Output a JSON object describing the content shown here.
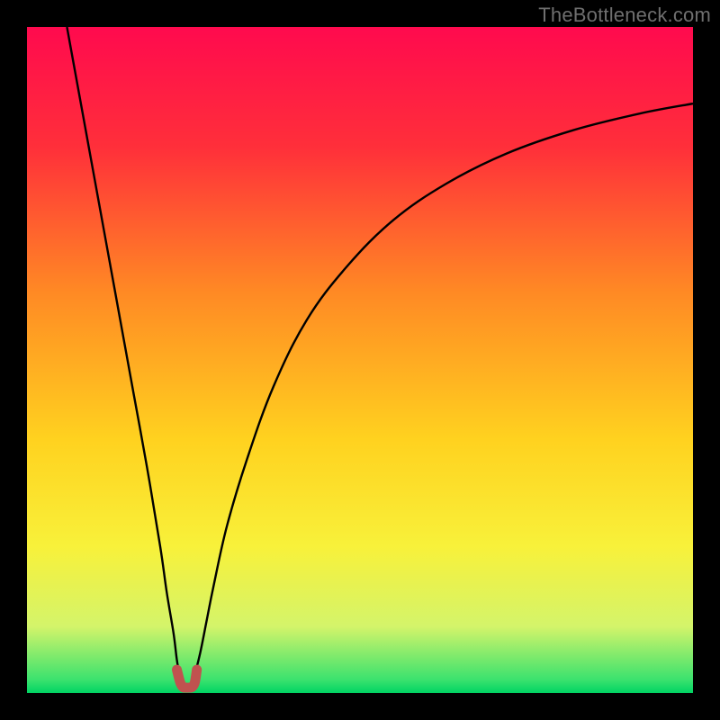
{
  "watermark": "TheBottleneck.com",
  "chart_data": {
    "type": "line",
    "title": "",
    "xlabel": "",
    "ylabel": "",
    "x_range": [
      0,
      100
    ],
    "y_range": [
      0,
      100
    ],
    "grid": false,
    "legend": false,
    "colors": {
      "gradient_stops": [
        {
          "pos": 0.0,
          "color": "#ff0a4e"
        },
        {
          "pos": 0.18,
          "color": "#ff2f3a"
        },
        {
          "pos": 0.4,
          "color": "#ff8a24"
        },
        {
          "pos": 0.62,
          "color": "#ffd21f"
        },
        {
          "pos": 0.78,
          "color": "#f8f13a"
        },
        {
          "pos": 0.9,
          "color": "#d4f46a"
        },
        {
          "pos": 0.98,
          "color": "#3be26e"
        },
        {
          "pos": 1.0,
          "color": "#00d463"
        }
      ],
      "curve": "#000000",
      "marker": "#c0524f"
    },
    "left_curve": {
      "x": [
        6,
        8,
        10,
        12,
        14,
        16,
        18,
        20,
        21,
        22,
        22.5,
        23
      ],
      "y": [
        100,
        89,
        78,
        67,
        56,
        45,
        34,
        22,
        15,
        9,
        5,
        2
      ]
    },
    "right_curve": {
      "x": [
        25,
        26,
        27,
        28,
        30,
        33,
        37,
        42,
        48,
        55,
        63,
        72,
        82,
        92,
        100
      ],
      "y": [
        2,
        6,
        11,
        16,
        25,
        35,
        46,
        56,
        64,
        71,
        76.5,
        81,
        84.5,
        87,
        88.5
      ]
    },
    "trough_marker": {
      "x": [
        22.5,
        23,
        23.4,
        23.8,
        24.3,
        24.8,
        25.2,
        25.5
      ],
      "y": [
        3.5,
        1.6,
        0.9,
        0.8,
        0.8,
        0.9,
        1.6,
        3.5
      ]
    }
  }
}
